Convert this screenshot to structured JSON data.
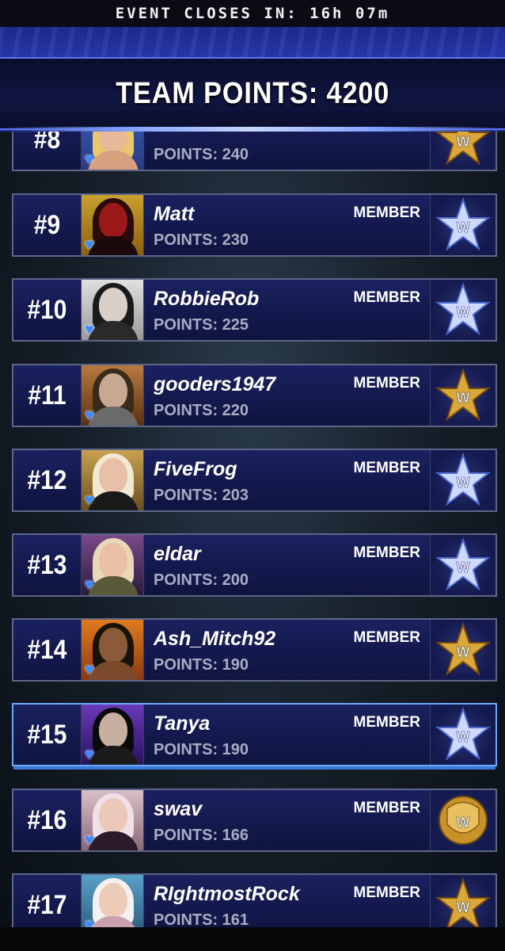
{
  "event": {
    "closes_label": "EVENT CLOSES IN: 16h 07m"
  },
  "team": {
    "points_label": "TEAM POINTS: 4200"
  },
  "colors": {
    "header_blue": "#2a3bb5",
    "row_bg": "#141a4e",
    "heart": "#3b8bff",
    "silver_star": "#cfd8ff",
    "gold_star": "#d8a83a"
  },
  "rows": [
    {
      "rank": "#8",
      "name": "",
      "points": "POINTS: 240",
      "role": "",
      "badge": "gold-star-icon"
    },
    {
      "rank": "#9",
      "name": "Matt",
      "points": "POINTS: 230",
      "role": "MEMBER",
      "badge": "silver-star-icon"
    },
    {
      "rank": "#10",
      "name": "RobbieRob",
      "points": "POINTS: 225",
      "role": "MEMBER",
      "badge": "silver-star-icon"
    },
    {
      "rank": "#11",
      "name": "gooders1947",
      "points": "POINTS: 220",
      "role": "MEMBER",
      "badge": "gold-star-icon"
    },
    {
      "rank": "#12",
      "name": "FiveFrog",
      "points": "POINTS: 203",
      "role": "MEMBER",
      "badge": "silver-star-icon"
    },
    {
      "rank": "#13",
      "name": "eldar",
      "points": "POINTS: 200",
      "role": "MEMBER",
      "badge": "silver-star-icon"
    },
    {
      "rank": "#14",
      "name": "Ash_Mitch92",
      "points": "POINTS: 190",
      "role": "MEMBER",
      "badge": "gold-star-icon"
    },
    {
      "rank": "#15",
      "name": "Tanya",
      "points": "POINTS: 190",
      "role": "MEMBER",
      "badge": "silver-star-icon"
    },
    {
      "rank": "#16",
      "name": "swav",
      "points": "POINTS: 166",
      "role": "MEMBER",
      "badge": "gold-shield-icon"
    },
    {
      "rank": "#17",
      "name": "RIghtmostRock",
      "points": "POINTS: 161",
      "role": "MEMBER",
      "badge": "gold-star-icon"
    }
  ]
}
